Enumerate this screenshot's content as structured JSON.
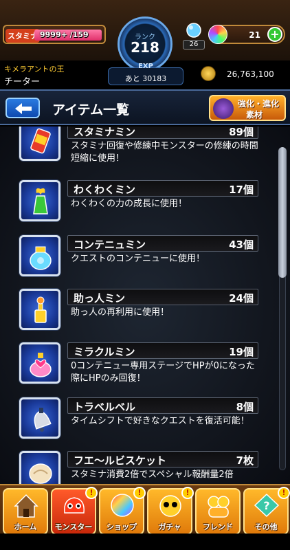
{
  "status": {
    "stamina_label": "スタミナ",
    "stamina_value": "9999+ /159",
    "stamina_fraction": 1.0,
    "rank_label": "ランク",
    "rank_value": "218",
    "exp_label": "EXP",
    "exp_remaining": "あと 30183",
    "small_orb_count": "26",
    "orb_count": "21",
    "orb_plus": "+",
    "user_title": "キメラアントの王",
    "user_name": "チーター",
    "coins": "26,763,100"
  },
  "header": {
    "title": "アイテム一覧",
    "upgrade_line1": "強化・進化",
    "upgrade_line2": "素材"
  },
  "items": [
    {
      "name": "スタミナミン",
      "count": "89個",
      "desc": "スタミナ回復や修練中モンスターの修練の時間短縮に使用！",
      "icon": "stamina-can-icon"
    },
    {
      "name": "わくわくミン",
      "count": "17個",
      "desc": "わくわくの力の成長に使用！",
      "icon": "green-bottle-icon"
    },
    {
      "name": "コンテニュミン",
      "count": "43個",
      "desc": "クエストのコンテニューに使用！",
      "icon": "blue-jar-icon"
    },
    {
      "name": "助っ人ミン",
      "count": "24個",
      "desc": "助っ人の再利用に使用！",
      "icon": "yellow-bottle-icon"
    },
    {
      "name": "ミラクルミン",
      "count": "19個",
      "desc": "0コンテニュー専用ステージでHPが0になった際にHPのみ回復！",
      "icon": "heart-potion-icon"
    },
    {
      "name": "トラベルベル",
      "count": "8個",
      "desc": "タイムシフトで好きなクエストを復活可能！",
      "icon": "bell-icon"
    },
    {
      "name": "フエ～ルビスケット",
      "count": "7枚",
      "desc": "スタミナ消費2倍でスペシャル報酬量2倍",
      "icon": "biscuit-icon"
    }
  ],
  "nav": [
    {
      "label": "ホーム",
      "icon": "home-icon",
      "badge": ""
    },
    {
      "label": "モンスター",
      "icon": "monster-icon",
      "badge": "!"
    },
    {
      "label": "ショップ",
      "icon": "shop-orb-icon",
      "badge": "!"
    },
    {
      "label": "ガチャ",
      "icon": "gacha-icon",
      "badge": "!"
    },
    {
      "label": "フレンド",
      "icon": "friend-icon",
      "badge": ""
    },
    {
      "label": "その他",
      "icon": "other-icon",
      "badge": "!"
    }
  ],
  "colors": {
    "accent_orange": "#e07a0a",
    "header_blue": "#0e4ab0",
    "item_icon_blue": "#1a3a9a"
  }
}
